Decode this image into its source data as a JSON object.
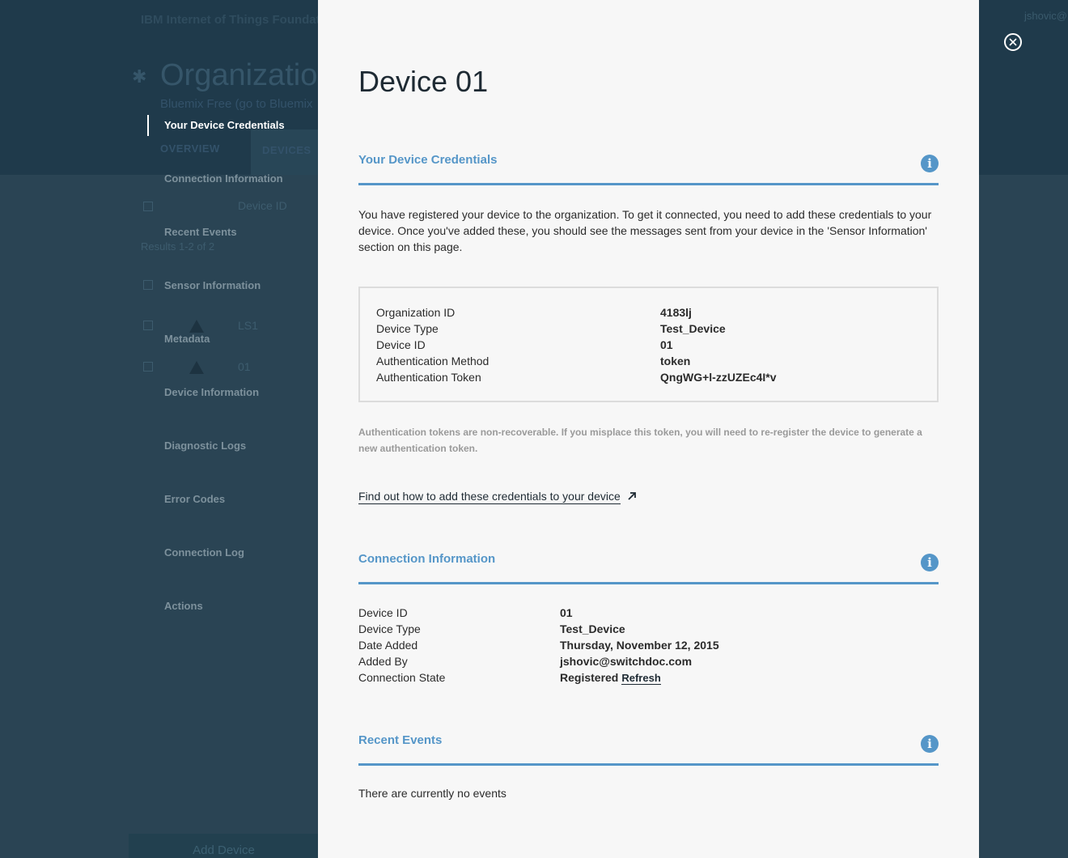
{
  "background": {
    "app_title": "IBM Internet of Things Foundat",
    "user": "jshovic@",
    "org_heading": "Organization",
    "plan_text": "Bluemix Free (go to Bluemix",
    "tabs": [
      "OVERVIEW",
      "DEVICES"
    ],
    "column_device_id": "Device ID",
    "results": "Results 1-2 of 2",
    "rows": [
      "LS1",
      "01"
    ],
    "add_device": "Add Device"
  },
  "nav": {
    "items": [
      "Your Device Credentials",
      "Connection Information",
      "Recent Events",
      "Sensor Information",
      "Metadata",
      "Device Information",
      "Diagnostic Logs",
      "Error Codes",
      "Connection Log",
      "Actions"
    ],
    "active_index": 0
  },
  "panel": {
    "title": "Device 01",
    "credentials": {
      "heading": "Your Device Credentials",
      "intro": "You have registered your device to the organization. To get it connected, you need to add these credentials to your device. Once you've added these, you should see the messages sent from your device in the 'Sensor Information' section on this page.",
      "fields": [
        {
          "label": "Organization ID",
          "value": "4183lj"
        },
        {
          "label": "Device Type",
          "value": "Test_Device"
        },
        {
          "label": "Device ID",
          "value": "01"
        },
        {
          "label": "Authentication Method",
          "value": "token"
        },
        {
          "label": "Authentication Token",
          "value": "QngWG+l-zzUZEc4I*v"
        }
      ],
      "note": "Authentication tokens are non-recoverable. If you misplace this token, you will need to re-register the device to generate a new authentication token.",
      "link": "Find out how to add these credentials to your device"
    },
    "connection": {
      "heading": "Connection Information",
      "fields": [
        {
          "label": "Device ID",
          "value": "01"
        },
        {
          "label": "Device Type",
          "value": "Test_Device"
        },
        {
          "label": "Date Added",
          "value": "Thursday, November 12, 2015"
        },
        {
          "label": "Added By",
          "value": "jshovic@switchdoc.com"
        },
        {
          "label": "Connection State",
          "value": "Registered"
        }
      ],
      "refresh": "Refresh"
    },
    "events": {
      "heading": "Recent Events",
      "empty_text": "There are currently no events"
    }
  },
  "colors": {
    "accent": "#5596c8",
    "panel_bg": "#f7f7f7",
    "backdrop": "#2c4655"
  }
}
